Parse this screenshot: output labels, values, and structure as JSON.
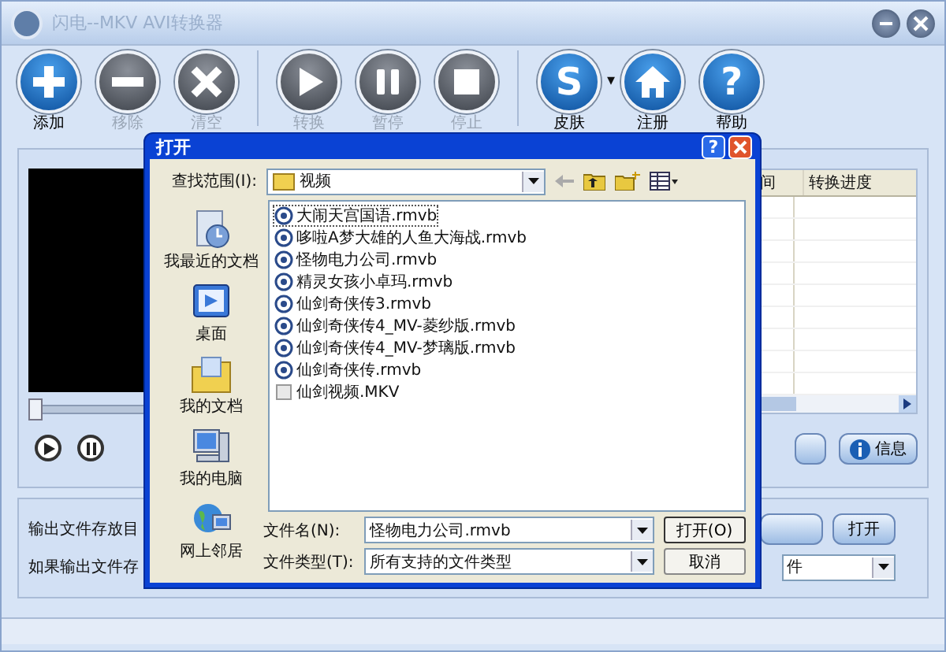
{
  "window": {
    "title": "闪电--MKV AVI转换器"
  },
  "toolbar": [
    {
      "kind": "add",
      "label": "添加",
      "disabled": false
    },
    {
      "kind": "remove",
      "label": "移除",
      "disabled": true
    },
    {
      "kind": "clear",
      "label": "清空",
      "disabled": true
    },
    {
      "kind": "play",
      "label": "转换",
      "disabled": true,
      "separator": true
    },
    {
      "kind": "pause",
      "label": "暂停",
      "disabled": true
    },
    {
      "kind": "stop",
      "label": "停止",
      "disabled": true
    },
    {
      "kind": "glyph",
      "glyph": "S",
      "label": "皮肤",
      "disabled": false,
      "separator": true,
      "caret": "▾"
    },
    {
      "kind": "home",
      "label": "注册",
      "disabled": false
    },
    {
      "kind": "glyph",
      "glyph": "?",
      "label": "帮助",
      "disabled": false
    }
  ],
  "player": {
    "level": 0.0
  },
  "table": {
    "columns": [
      "间",
      "转换进度"
    ]
  },
  "info_button": "信息",
  "output": {
    "dir_label": "输出文件存放目",
    "exists_label": "如果输出文件存",
    "open_button": "打开",
    "option_value": "件"
  },
  "dialog": {
    "title": "打开",
    "help_glyph": "?",
    "look_in_label": "查找范围(I):",
    "look_in_value": "视频",
    "places": [
      {
        "kind": "recent",
        "label": "我最近的文档"
      },
      {
        "kind": "desktop",
        "label": "桌面"
      },
      {
        "kind": "docs",
        "label": "我的文档"
      },
      {
        "kind": "computer",
        "label": "我的电脑"
      },
      {
        "kind": "network",
        "label": "网上邻居"
      }
    ],
    "files": [
      {
        "kind": "rmvb",
        "name": "大闹天宫国语.rmvb",
        "focused": true
      },
      {
        "kind": "rmvb",
        "name": "哆啦A梦大雄的人鱼大海战.rmvb",
        "focused": false
      },
      {
        "kind": "rmvb",
        "name": "怪物电力公司.rmvb",
        "focused": false
      },
      {
        "kind": "rmvb",
        "name": "精灵女孩小卓玛.rmvb",
        "focused": false
      },
      {
        "kind": "rmvb",
        "name": "仙剑奇侠传3.rmvb",
        "focused": false
      },
      {
        "kind": "rmvb",
        "name": "仙剑奇侠传4_MV-菱纱版.rmvb",
        "focused": false
      },
      {
        "kind": "rmvb",
        "name": "仙剑奇侠传4_MV-梦璃版.rmvb",
        "focused": false
      },
      {
        "kind": "rmvb",
        "name": "仙剑奇侠传.rmvb",
        "focused": false
      },
      {
        "kind": "mkv",
        "name": "仙剑视频.MKV",
        "focused": false
      }
    ],
    "filename_label": "文件名(N):",
    "filename_value": "怪物电力公司.rmvb",
    "filetype_label": "文件类型(T):",
    "filetype_value": "所有支持的文件类型",
    "open_button": "打开(O)",
    "cancel_button": "取消"
  }
}
